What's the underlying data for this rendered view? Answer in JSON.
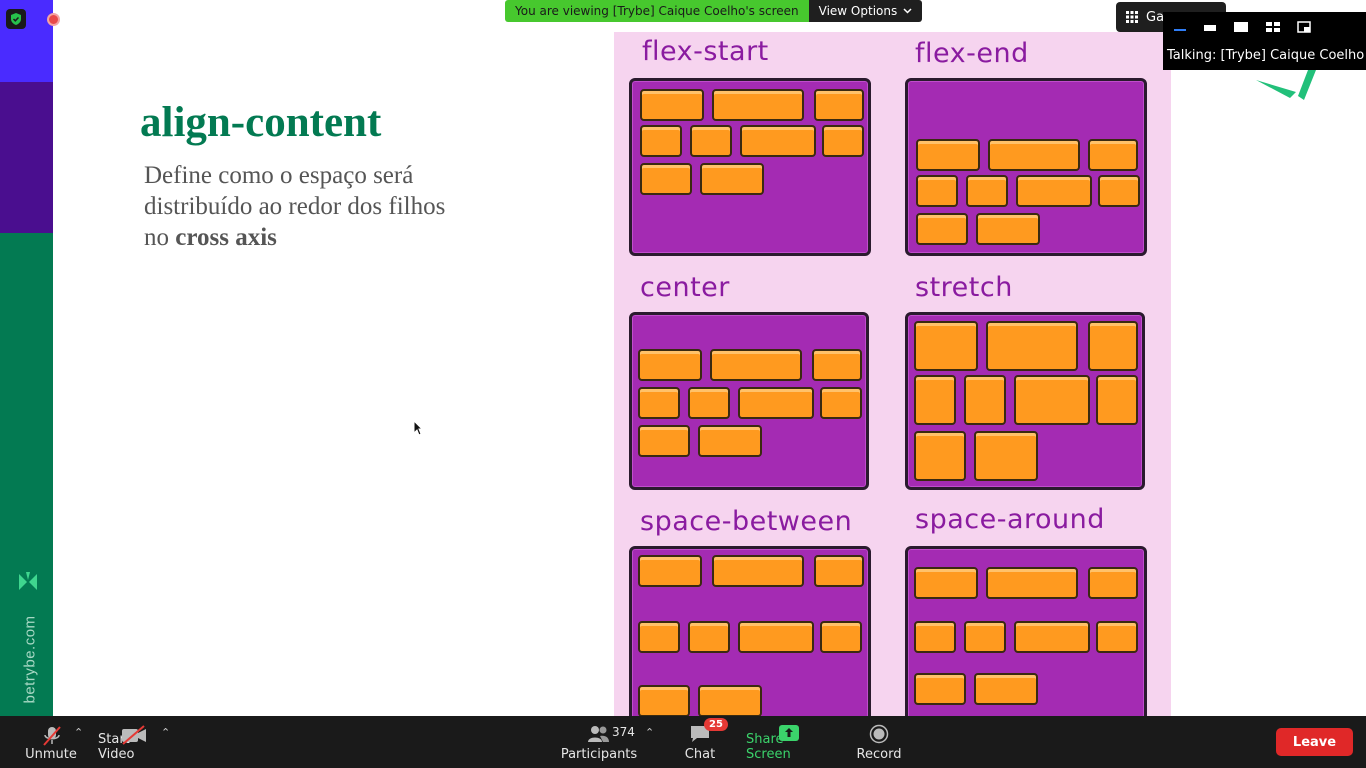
{
  "sidebar": {
    "brand_text": "betrybe.com"
  },
  "slide": {
    "title": "align-content",
    "body_prefix": "Define como o espaço será distribuído ao redor dos filhos no ",
    "body_bold": "cross axis"
  },
  "illustration": {
    "panels": [
      {
        "label": "flex-start"
      },
      {
        "label": "flex-end"
      },
      {
        "label": "center"
      },
      {
        "label": "stretch"
      },
      {
        "label": "space-between"
      },
      {
        "label": "space-around"
      }
    ]
  },
  "share_banner": {
    "viewing_text": "You are viewing [Trybe] Caique Coelho's screen",
    "view_options_label": "View Options"
  },
  "view_controls": {
    "gallery_label": "Ga"
  },
  "talking_indicator": {
    "text": "Talking: [Trybe] Caique Coelho"
  },
  "toolbar": {
    "unmute_label": "Unmute",
    "start_video_label": "Start Video",
    "participants_label": "Participants",
    "participants_count": "374",
    "chat_label": "Chat",
    "chat_badge": "25",
    "share_screen_label": "Share Screen",
    "record_label": "Record",
    "leave_label": "Leave"
  },
  "colors": {
    "brand_green": "#037a52",
    "brand_purple": "#4a0e8f",
    "brand_blue": "#4a2bff",
    "panel_purple": "#a42bb3",
    "brick_orange": "#ff9a1f",
    "leave_red": "#e02828",
    "share_green": "#3bd36b"
  }
}
